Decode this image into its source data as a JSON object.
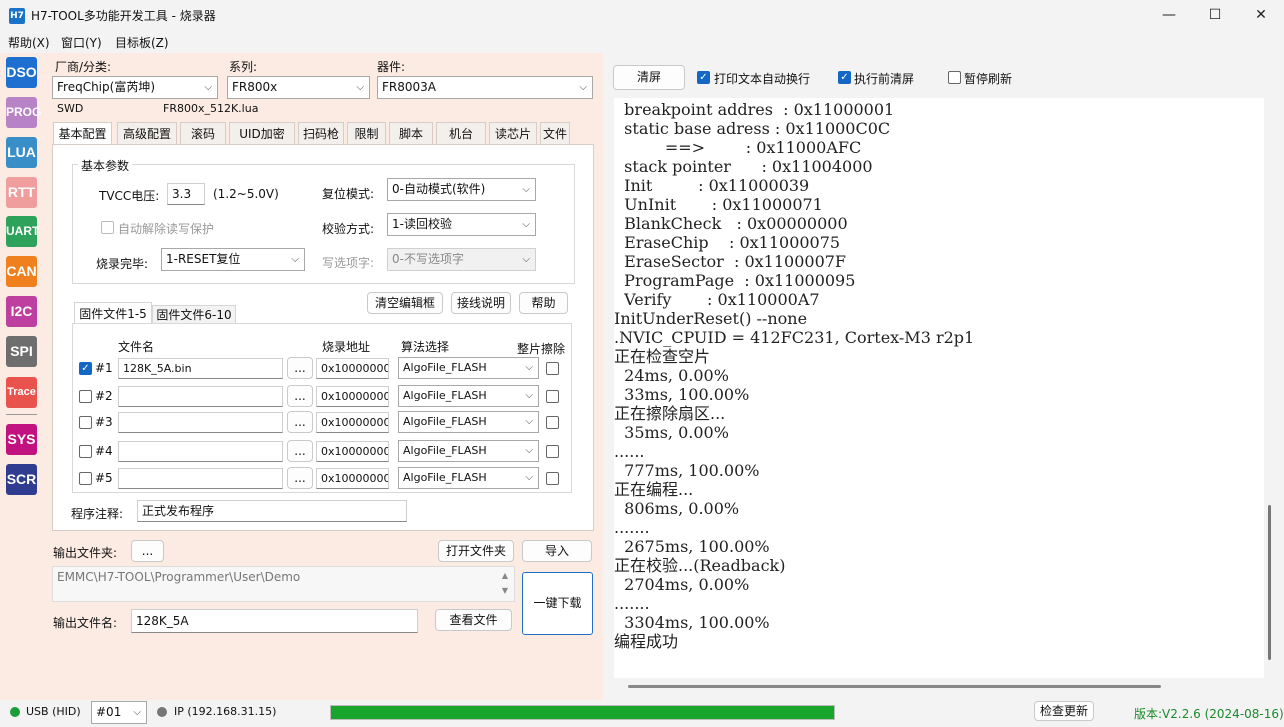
{
  "window": {
    "title": "H7-TOOL多功能开发工具 - 烧录器",
    "icon_text": "H7",
    "min": "—",
    "max": "☐",
    "close": "✕"
  },
  "menu": [
    "帮助(X)",
    "窗口(Y)",
    "目标板(Z)"
  ],
  "sidebar": [
    {
      "label": "DSO",
      "color": "#1f6fd0"
    },
    {
      "label": "PROG",
      "color": "#b882c6"
    },
    {
      "label": "LUA",
      "color": "#3a8ec8"
    },
    {
      "label": "RTT",
      "color": "#f09d9d"
    },
    {
      "label": "UART",
      "color": "#2ea15a"
    },
    {
      "label": "CAN",
      "color": "#f07f1d"
    },
    {
      "label": "I2C",
      "color": "#bd3fa0"
    },
    {
      "label": "SPI",
      "color": "#6e6e6e"
    },
    {
      "label": "Trace",
      "color": "#e8534d"
    },
    {
      "label": "SYS",
      "color": "#c1127f"
    },
    {
      "label": "SCR",
      "color": "#2f3c8f"
    }
  ],
  "device": {
    "vendor_label": "厂商/分类:",
    "vendor": "FreqChip(富芮坤)",
    "series_label": "系列:",
    "series": "FR800x",
    "part_label": "器件:",
    "part": "FR8003A",
    "interface": "SWD",
    "lua_file": "FR800x_512K.lua"
  },
  "tabs": [
    "基本配置",
    "高级配置",
    "滚码",
    "UID加密",
    "扫码枪",
    "限制",
    "脚本",
    "机台",
    "读芯片",
    "文件"
  ],
  "basic": {
    "group_title": "基本参数",
    "tvcc_label": "TVCC电压:",
    "tvcc_value": "3.3",
    "tvcc_range": "(1.2~5.0V)",
    "auto_unlock": "自动解除读写保护",
    "done_label": "烧录完毕:",
    "done_value": "1-RESET复位",
    "reset_label": "复位模式:",
    "reset_value": "0-自动模式(软件)",
    "verify_label": "校验方式:",
    "verify_value": "1-读回校验",
    "writeopt_label": "写选项字:",
    "writeopt_value": "0-不写选项字"
  },
  "files": {
    "tab1": "固件文件1-5",
    "tab2": "固件文件6-10",
    "clear_btn": "清空编辑框",
    "wiring_btn": "接线说明",
    "help_btn": "帮助",
    "col_name": "文件名",
    "col_addr": "烧录地址",
    "col_algo": "算法选择",
    "col_erase": "整片擦除",
    "browse": "...",
    "rows": [
      {
        "num": "#1",
        "checked": true,
        "file": "128K_5A.bin",
        "addr": "0x10000000",
        "algo": "AlgoFile_FLASH"
      },
      {
        "num": "#2",
        "checked": false,
        "file": "",
        "addr": "0x10000000",
        "algo": "AlgoFile_FLASH"
      },
      {
        "num": "#3",
        "checked": false,
        "file": "",
        "addr": "0x10000000",
        "algo": "AlgoFile_FLASH"
      },
      {
        "num": "#4",
        "checked": false,
        "file": "",
        "addr": "0x10000000",
        "algo": "AlgoFile_FLASH"
      },
      {
        "num": "#5",
        "checked": false,
        "file": "",
        "addr": "0x10000000",
        "algo": "AlgoFile_FLASH"
      }
    ],
    "note_label": "程序注释:",
    "note_value": "正式发布程序"
  },
  "output": {
    "folder_label": "输出文件夹:",
    "folder_btn": "...",
    "open_btn": "打开文件夹",
    "import_btn": "导入",
    "path": "EMMC\\H7-TOOL\\Programmer\\User\\Demo",
    "filename_label": "输出文件名:",
    "filename": "128K_5A",
    "view_btn": "查看文件",
    "download_btn": "一键下载"
  },
  "right": {
    "clear_btn": "清屏",
    "wrap_label": "打印文本自动换行",
    "wrap_checked": true,
    "clear_before_label": "执行前清屏",
    "clear_before_checked": true,
    "pause_label": "暂停刷新",
    "pause_checked": false
  },
  "console_lines": [
    "  breakpoint addres  : 0x11000001",
    "  static base adress : 0x11000C0C",
    "          ==>        : 0x11000AFC",
    "  stack pointer      : 0x11004000",
    "  Init         : 0x11000039",
    "  UnInit       : 0x11000071",
    "  BlankCheck   : 0x00000000",
    "  EraseChip    : 0x11000075",
    "  EraseSector  : 0x1100007F",
    "  ProgramPage  : 0x11000095",
    "  Verify       : 0x110000A7",
    "InitUnderReset() --none",
    ".NVIC_CPUID = 412FC231, Cortex-M3 r2p1",
    "正在检查空片",
    "  24ms, 0.00%",
    "  33ms, 100.00%",
    "正在擦除扇区...",
    "  35ms, 0.00%",
    "......",
    "  777ms, 100.00%",
    "正在编程...",
    "  806ms, 0.00%",
    ".......",
    "  2675ms, 100.00%",
    "正在校验...(Readback)",
    "  2704ms, 0.00%",
    ".......",
    "  3304ms, 100.00%",
    "编程成功"
  ],
  "status": {
    "usb": "USB (HID)",
    "usb_color": "#1a9e3a",
    "port": "#01",
    "ip": "IP (192.168.31.15)",
    "ip_color": "#777777",
    "progress": 1.0,
    "progress_color": "#18a52c",
    "check_btn": "检查更新",
    "version": "版本:V2.2.6 (2024-08-16)"
  }
}
